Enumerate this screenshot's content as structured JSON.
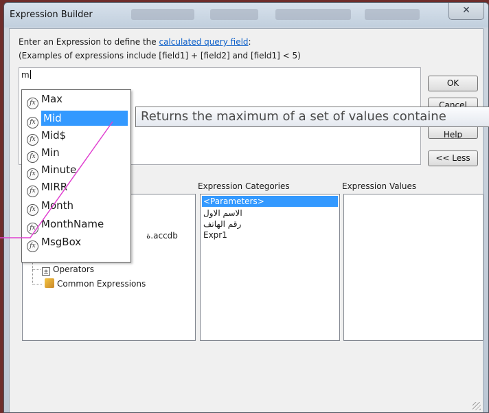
{
  "window": {
    "title": "Expression Builder",
    "close_glyph": "✕"
  },
  "intro": {
    "line1_prefix": "Enter an Expression to define the ",
    "line1_link": "calculated query field",
    "line1_suffix": ":",
    "line2": "(Examples of expressions include [field1] + [field2] and [field1] < 5)"
  },
  "expression": {
    "value": "m"
  },
  "buttons": {
    "ok": "OK",
    "cancel": "Cancel",
    "help": "Help",
    "less": "<< Less"
  },
  "columns": {
    "categories_label": "Expression Categories",
    "values_label": "Expression Values"
  },
  "elements_tree": {
    "db_suffix": "ة.accdb",
    "operators": "Operators",
    "common": "Common Expressions"
  },
  "categories": [
    "<Parameters>",
    "الاسم الاول",
    "رقم الهاتف",
    "Expr1"
  ],
  "autocomplete": {
    "items": [
      "Max",
      "Mid",
      "Mid$",
      "Min",
      "Minute",
      "MIRR",
      "Month",
      "MonthName",
      "MsgBox"
    ],
    "selected_index": 1,
    "tooltip": "Returns the maximum of a set of values containe"
  },
  "colors": {
    "selection": "#3399ff",
    "link": "#0c5fc9",
    "annotation_line": "#e040d0"
  }
}
